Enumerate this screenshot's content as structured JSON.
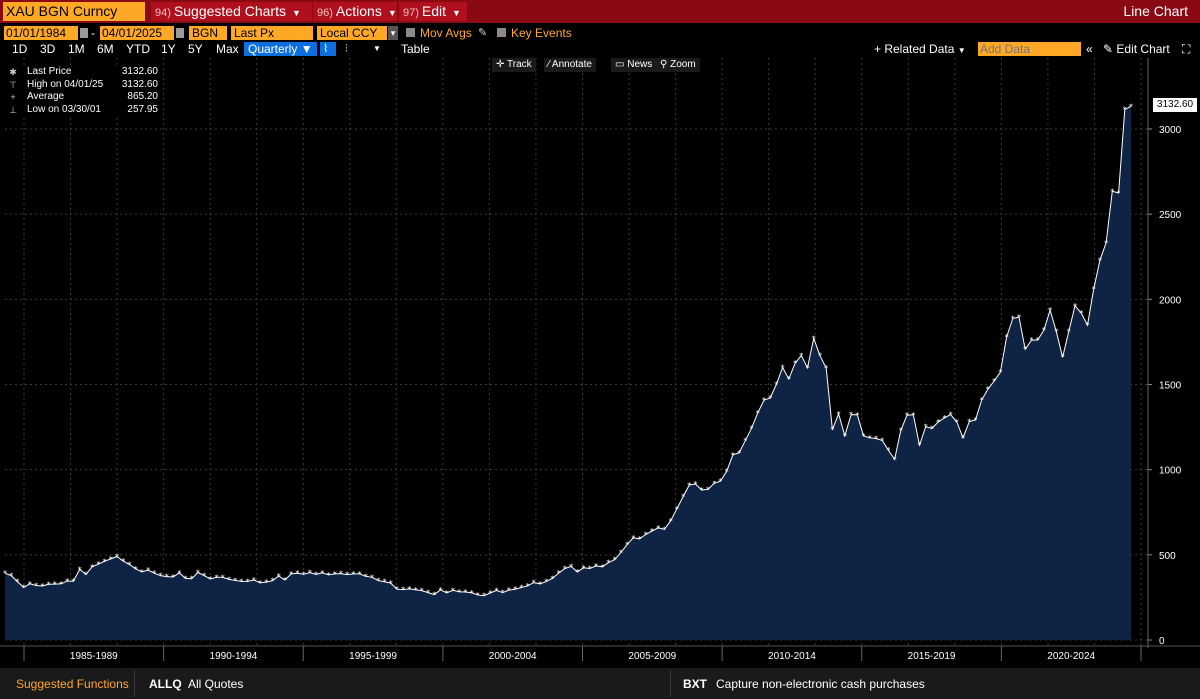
{
  "topbar": {
    "ticker": "XAU BGN Curncy",
    "menus": [
      {
        "num": "94)",
        "label": "Suggested Charts"
      },
      {
        "num": "96)",
        "label": "Actions"
      },
      {
        "num": "97)",
        "label": "Edit"
      }
    ],
    "chart_type_label": "Line Chart"
  },
  "controls": {
    "start_date": "01/01/1984",
    "end_date": "04/01/2025",
    "source": "BGN",
    "field": "Last Px",
    "currency": "Local CCY",
    "mov_avgs": "Mov Avgs",
    "key_events": "Key Events",
    "timeframes": [
      "1D",
      "3D",
      "1M",
      "6M",
      "YTD",
      "1Y",
      "5Y",
      "Max"
    ],
    "periodicity": "Quarterly",
    "table_label": "Table",
    "related_data": "+ Related Data",
    "add_data_placeholder": "Add Data",
    "edit_chart": "Edit Chart"
  },
  "toolbar": {
    "track": "Track",
    "annotate": "Annotate",
    "news": "News",
    "zoom": "Zoom"
  },
  "legend": {
    "rows": [
      {
        "icon": "✱",
        "key": "Last Price",
        "value": "3132.60"
      },
      {
        "icon": "⊤",
        "key": "High on 04/01/25",
        "value": "3132.60"
      },
      {
        "icon": "+",
        "key": "Average",
        "value": "865.20"
      },
      {
        "icon": "⊥",
        "key": "Low on 03/30/01",
        "value": "257.95"
      }
    ]
  },
  "last_price_tag": "3132.60",
  "chart_data": {
    "type": "area",
    "series": [
      {
        "name": "Last Price",
        "start": "1984Q1",
        "values": [
          392,
          378,
          342,
          309,
          330,
          320,
          317,
          327,
          328,
          330,
          346,
          345,
          415,
          385,
          430,
          445,
          462,
          476,
          490,
          463,
          444,
          418,
          400,
          410,
          392,
          378,
          372,
          370,
          394,
          362,
          360,
          396,
          378,
          358,
          368,
          368,
          356,
          350,
          344,
          344,
          352,
          336,
          340,
          348,
          376,
          352,
          388,
          392,
          386,
          395,
          386,
          394,
          383,
          388,
          390,
          384,
          388,
          388,
          374,
          368,
          348,
          342,
          334,
          298,
          296,
          300,
          295,
          290,
          278,
          266,
          295,
          277,
          292,
          283,
          282,
          277,
          265,
          260,
          276,
          291,
          278,
          293,
          298,
          308,
          318,
          337,
          330,
          343,
          362,
          393,
          420,
          432,
          400,
          424,
          420,
          435,
          430,
          454,
          472,
          514,
          560,
          600,
          594,
          620,
          640,
          658,
          650,
          700,
          770,
          842,
          910,
          916,
          880,
          885,
          920,
          932,
          990,
          1087,
          1099,
          1170,
          1243,
          1333,
          1408,
          1421,
          1501,
          1600,
          1532,
          1625,
          1670,
          1598,
          1771,
          1669,
          1596,
          1235,
          1328,
          1199,
          1323,
          1322,
          1198,
          1187,
          1183,
          1172,
          1114,
          1060,
          1231,
          1320,
          1322,
          1144,
          1252,
          1242,
          1280,
          1304,
          1324,
          1280,
          1187,
          1282,
          1292,
          1409,
          1473,
          1520,
          1572,
          1779,
          1888,
          1895,
          1707,
          1760,
          1762,
          1819,
          1937,
          1811,
          1660,
          1812,
          1962,
          1920,
          1848,
          2060,
          2229,
          2332,
          2634,
          2624,
          3115,
          3132.6
        ]
      }
    ],
    "ylim": [
      0,
      3300
    ],
    "yticks": [
      0,
      500,
      1000,
      1500,
      2000,
      2500,
      3000
    ],
    "xticks": [
      "1985-1989",
      "1990-1994",
      "1995-1999",
      "2000-2004",
      "2005-2009",
      "2010-2014",
      "2015-2019",
      "2020-2024"
    ],
    "grid": true,
    "legend": "top-left"
  },
  "bottom": {
    "suggested": "Suggested Functions",
    "allq_code": "ALLQ",
    "allq_label": "All Quotes",
    "bxt_code": "BXT",
    "bxt_label": "Capture non-electronic cash purchases"
  },
  "colors": {
    "topbar": "#8a0a14",
    "accent": "#ffa826",
    "area_fill": "#0f2444",
    "line": "#ffffff"
  }
}
